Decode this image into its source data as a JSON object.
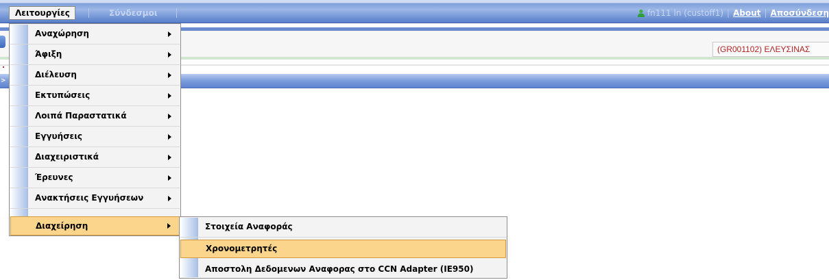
{
  "menubar": {
    "active_menu": "Λειτουργίες",
    "links_menu": "Σύνδεσμοι",
    "user_text": "fn111 ln (custoff1)",
    "about": "About",
    "logout": "Αποσύνδεση"
  },
  "office": {
    "label": "(GR001102) ΕΛΕΥΣΙΝΑΣ"
  },
  "operations_menu": {
    "items": [
      {
        "label": "Αναχώρηση"
      },
      {
        "label": "Άφιξη"
      },
      {
        "label": "Διέλευση"
      },
      {
        "label": "Εκτυπώσεις"
      },
      {
        "label": "Λοιπά Παραστατικά"
      },
      {
        "label": "Εγγυήσεις"
      },
      {
        "label": "Διαχειριστικά"
      },
      {
        "label": "Έρευνες"
      },
      {
        "label": "Ανακτήσεις Εγγυήσεων"
      },
      {
        "label": "Διαχείρηση"
      }
    ],
    "active_index": 9
  },
  "management_submenu": {
    "items": [
      {
        "label": "Στοιχεία Αναφοράς"
      },
      {
        "label": "Χρονομετρητές"
      },
      {
        "label": "Αποστολη Δεδομενων Αναφορας στο CCN Adapter (IE950)"
      }
    ],
    "hover_index": 1
  },
  "colors": {
    "menubar_blue": "#6f92d4",
    "highlight": "#fbd58c",
    "office_text": "#b22222"
  },
  "icons": {
    "user": "user-icon",
    "submenu_arrow": "chevron-right-icon"
  }
}
